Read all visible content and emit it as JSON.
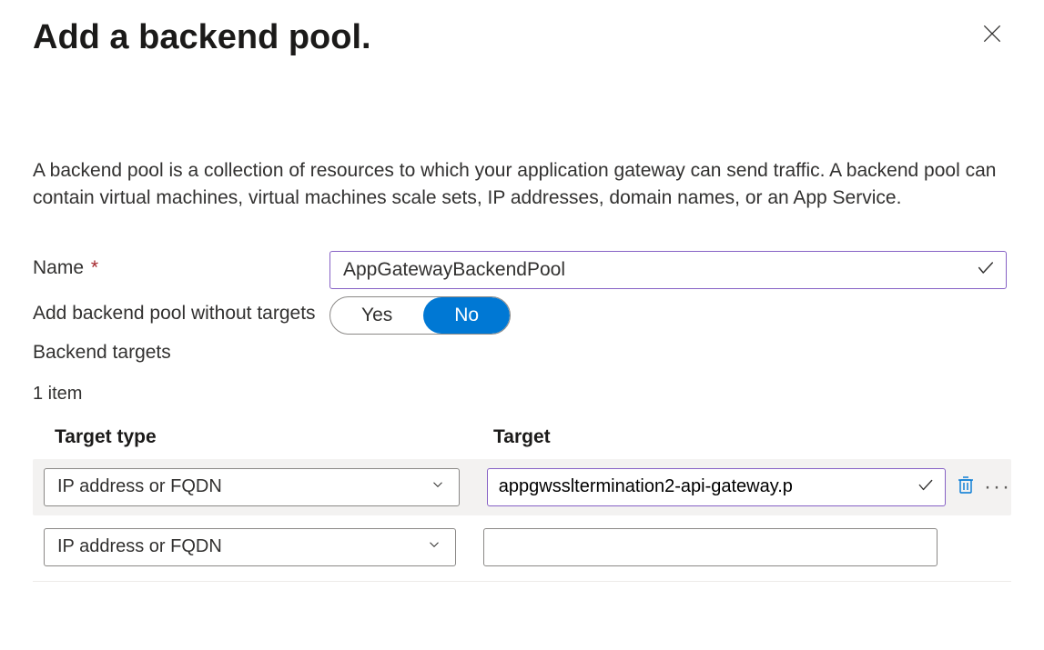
{
  "title": "Add a backend pool.",
  "description": "A backend pool is a collection of resources to which your application gateway can send traffic. A backend pool can contain virtual machines, virtual machines scale sets, IP addresses, domain names, or an App Service.",
  "fields": {
    "name_label": "Name",
    "name_value": "AppGatewayBackendPool",
    "no_targets_label": "Add backend pool without targets",
    "toggle_yes": "Yes",
    "toggle_no": "No",
    "toggle_selected": "No"
  },
  "targets": {
    "heading": "Backend targets",
    "count_text": "1 item",
    "col_type": "Target type",
    "col_target": "Target",
    "rows": [
      {
        "type": "IP address or FQDN",
        "target": "appgwssltermination2-api-gateway.p",
        "valid": true
      },
      {
        "type": "IP address or FQDN",
        "target": ""
      }
    ]
  }
}
